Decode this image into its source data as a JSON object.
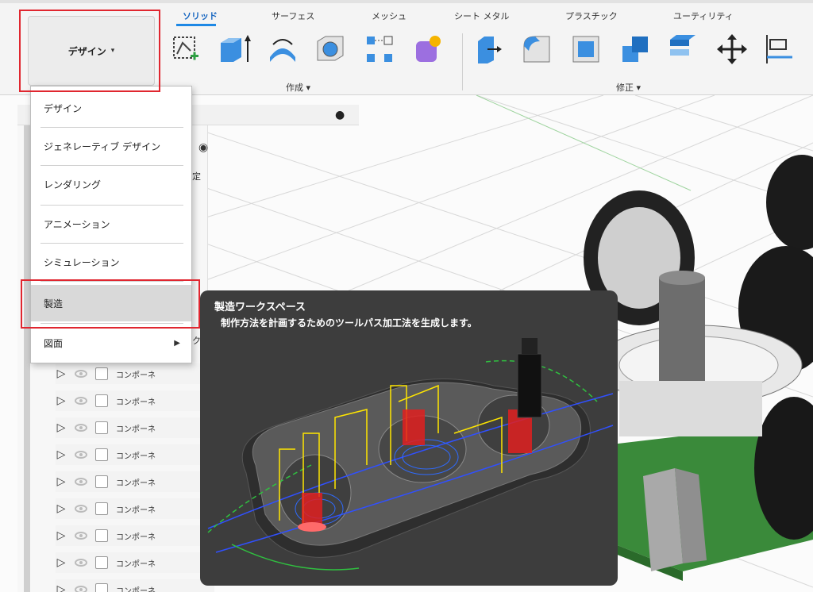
{
  "tabs": [
    {
      "label": "ソリッド",
      "active": true
    },
    {
      "label": "サーフェス",
      "active": false
    },
    {
      "label": "メッシュ",
      "active": false
    },
    {
      "label": "シート メタル",
      "active": false
    },
    {
      "label": "プラスチック",
      "active": false
    },
    {
      "label": "ユーティリティ",
      "active": false
    }
  ],
  "workspace_button": {
    "label": "デザイン",
    "caret": "▾"
  },
  "groups": {
    "create": {
      "label": "作成 ▾",
      "icons": [
        "new-sketch-icon",
        "extrude-icon",
        "revolve-icon",
        "hole-icon",
        "pattern-icon",
        "create-form-icon"
      ]
    },
    "modify": {
      "label": "修正 ▾",
      "icons": [
        "press-pull-icon",
        "fillet-icon",
        "shell-icon",
        "combine-icon",
        "offset-face-icon",
        "move-icon",
        "align-icon"
      ]
    }
  },
  "menu": {
    "items": [
      {
        "label": "デザイン",
        "highlighted": false,
        "submenu": false
      },
      {
        "label": "ジェネレーティブ デザイン",
        "highlighted": false,
        "submenu": false
      },
      {
        "label": "レンダリング",
        "highlighted": false,
        "submenu": false
      },
      {
        "label": "アニメーション",
        "highlighted": false,
        "submenu": false
      },
      {
        "label": "シミュレーション",
        "highlighted": false,
        "submenu": false
      },
      {
        "label": "製造",
        "highlighted": true,
        "submenu": false
      },
      {
        "label": "図面",
        "highlighted": false,
        "submenu": true
      }
    ],
    "submenu_arrow": "▶"
  },
  "browser": {
    "partial_settei": "定",
    "partial_ku": "ク",
    "component_label": "コンポーネ",
    "component_rows": 9,
    "expand_glyph": "▷"
  },
  "tooltip": {
    "title": "製造ワークスペース",
    "description": "制作方法を計画するためのツールパス加工法を生成します。"
  },
  "colors": {
    "accent_blue": "#1e88e5",
    "highlight_red": "#e0262f",
    "tooltip_bg": "#3d3d3d",
    "menu_highlight": "#d9d9d9"
  }
}
